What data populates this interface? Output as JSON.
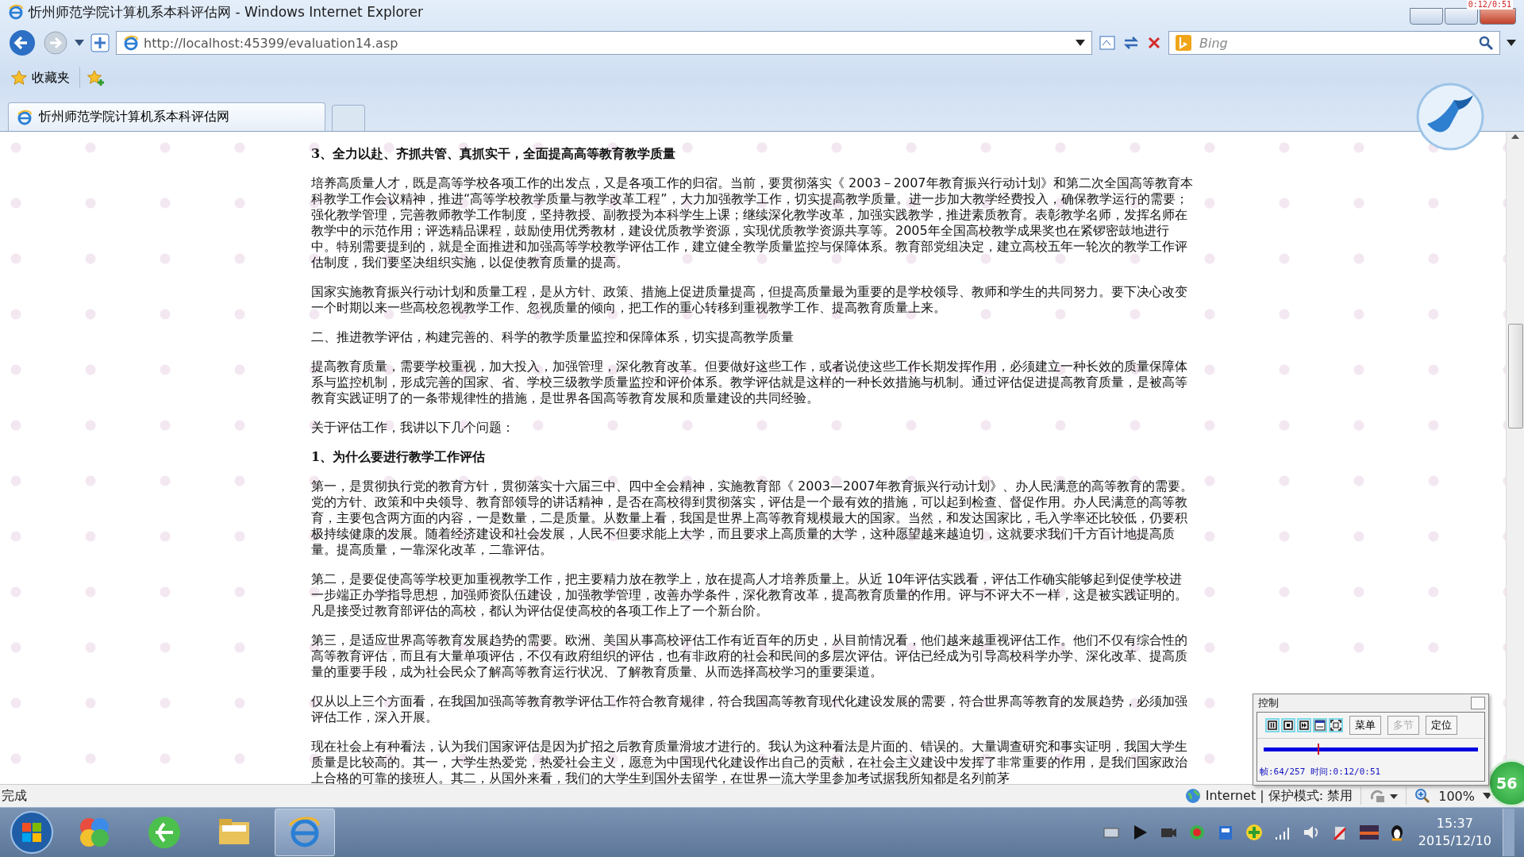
{
  "window": {
    "title": "忻州师范学院计算机系本科评估网 - Windows Internet Explorer",
    "corner_text": "0:12/0:51"
  },
  "address_bar": {
    "url": "http://localhost:45399/evaluation14.asp",
    "search_placeholder": "Bing"
  },
  "favorites_bar": {
    "label": "收藏夹"
  },
  "tabs": [
    {
      "label": "忻州师范学院计算机系本科评估网",
      "selected": true
    }
  ],
  "content": {
    "blocks": [
      {
        "kind": "heading",
        "text": "3、全力以赴、齐抓共管、真抓实干，全面提高高等教育教学质量"
      },
      {
        "kind": "text",
        "text": "培养高质量人才，既是高等学校各项工作的出发点，又是各项工作的归宿。当前，要贯彻落实《 2003－2007年教育振兴行动计划》和第二次全国高等教育本科教学工作会议精神，推进“高等学校教学质量与教学改革工程”，大力加强教学工作，切实提高教学质量。进一步加大教学经费投入，确保教学运行的需要；强化教学管理，完善教师教学工作制度，坚持教授、副教授为本科学生上课；继续深化教学改革，加强实践教学，推进素质教育。表彰教学名师，发挥名师在教学中的示范作用；评选精品课程，鼓励使用优秀教材，建设优质教学资源，实现优质教学资源共享等。2005年全国高校教学成果奖也在紧锣密鼓地进行中。特别需要提到的，就是全面推进和加强高等学校教学评估工作，建立健全教学质量监控与保障体系。教育部党组决定，建立高校五年一轮次的教学工作评估制度，我们要坚决组织实施，以促使教育质量的提高。"
      },
      {
        "kind": "text",
        "text": "国家实施教育振兴行动计划和质量工程，是从方针、政策、措施上促进质量提高，但提高质量最为重要的是学校领导、教师和学生的共同努力。要下决心改变一个时期以来一些高校忽视教学工作、忽视质量的倾向，把工作的重心转移到重视教学工作、提高教育质量上来。"
      },
      {
        "kind": "text",
        "text": "二、推进教学评估，构建完善的、科学的教学质量监控和保障体系，切实提高教学质量"
      },
      {
        "kind": "text",
        "text": "提高教育质量，需要学校重视，加大投入，加强管理，深化教育改革。但要做好这些工作，或者说使这些工作长期发挥作用，必须建立一种长效的质量保障体系与监控机制，形成完善的国家、省、学校三级教学质量监控和评价体系。教学评估就是这样的一种长效措施与机制。通过评估促进提高教育质量，是被高等教育实践证明了的一条带规律性的措施，是世界各国高等教育发展和质量建设的共同经验。"
      },
      {
        "kind": "text",
        "text": "关于评估工作，我讲以下几个问题："
      },
      {
        "kind": "heading",
        "text": "1、为什么要进行教学工作评估"
      },
      {
        "kind": "text",
        "text": "第一，是贯彻执行党的教育方针，贯彻落实十六届三中、四中全会精神，实施教育部《 2003—2007年教育振兴行动计划》、办人民满意的高等教育的需要。党的方针、政策和中央领导、教育部领导的讲话精神，是否在高校得到贯彻落实，评估是一个最有效的措施，可以起到检查、督促作用。办人民满意的高等教育，主要包含两方面的内容，一是数量，二是质量。从数量上看，我国是世界上高等教育规模最大的国家。当然，和发达国家比，毛入学率还比较低，仍要积极持续健康的发展。随着经济建设和社会发展，人民不但要求能上大学，而且要求上高质量的大学，这种愿望越来越迫切，这就要求我们千方百计地提高质量。提高质量，一靠深化改革，二靠评估。"
      },
      {
        "kind": "text",
        "text": "第二，是要促使高等学校更加重视教学工作，把主要精力放在教学上，放在提高人才培养质量上。从近 10年评估实践看，评估工作确实能够起到促使学校进一步端正办学指导思想，加强师资队伍建设，加强教学管理，改善办学条件，深化教育改革，提高教育质量的作用。评与不评大不一样，这是被实践证明的。凡是接受过教育部评估的高校，都认为评估促使高校的各项工作上了一个新台阶。"
      },
      {
        "kind": "text",
        "text": "第三，是适应世界高等教育发展趋势的需要。欧洲、美国从事高校评估工作有近百年的历史，从目前情况看，他们越来越重视评估工作。他们不仅有综合性的高等教育评估，而且有大量单项评估，不仅有政府组织的评估，也有非政府的社会和民间的多层次评估。评估已经成为引导高校科学办学、深化改革、提高质量的重要手段，成为社会民众了解高等教育运行状况、了解教育质量、从而选择高校学习的重要渠道。"
      },
      {
        "kind": "text",
        "text": "仅从以上三个方面看，在我国加强高等教育教学评估工作符合教育规律，符合我国高等教育现代化建设发展的需要，符合世界高等教育的发展趋势，必须加强评估工作，深入开展。"
      },
      {
        "kind": "text",
        "text": "现在社会上有种看法，认为我们国家评估是因为扩招之后教育质量滑坡才进行的。我认为这种看法是片面的、错误的。大量调查研究和事实证明，我国大学生质量是比较高的。其一，大学生热爱党，热爱社会主义，愿意为中国现代化建设作出自己的贡献，在社会主义建设中发挥了非常重要的作用，是我们国家政治上合格的可靠的接班人。其二，从国外来看，我们的大学生到国外去留学，在世界一流大学里参加考试据我所知都是名列前茅"
      }
    ]
  },
  "status_bar": {
    "status": "完成",
    "zone": "Internet | 保护模式: 禁用",
    "zoom": "100%"
  },
  "player_control": {
    "title": "控制",
    "buttons": [
      {
        "label": "菜单",
        "disabled": false
      },
      {
        "label": "多节",
        "disabled": true
      },
      {
        "label": "定位",
        "disabled": false
      }
    ],
    "level": 0.25,
    "info": "帧:64/257 时间:0:12/0:51"
  },
  "badge": {
    "text": "56"
  },
  "taskbar": {
    "time": "15:37",
    "date": "2015/12/10"
  }
}
